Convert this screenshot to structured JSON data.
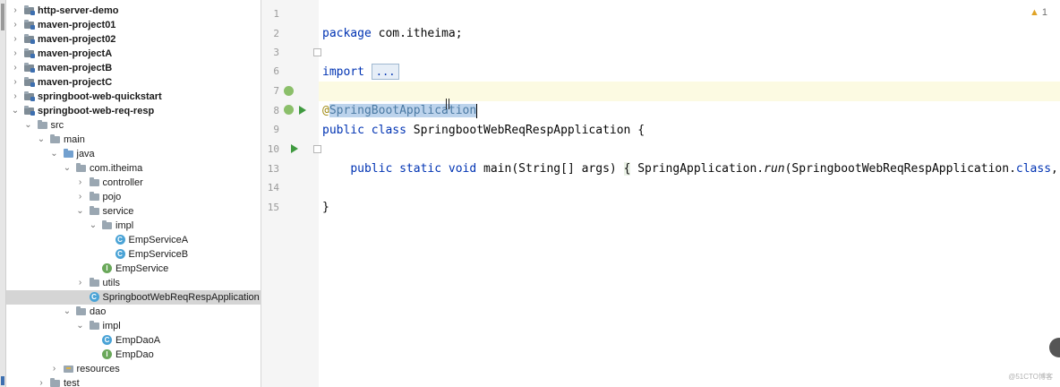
{
  "tree": {
    "items": [
      {
        "label": "http-server-demo",
        "icon": "module-folder-icon",
        "chevron": "right",
        "bold": true
      },
      {
        "label": "maven-project01",
        "icon": "module-folder-icon",
        "chevron": "right",
        "bold": true
      },
      {
        "label": "maven-project02",
        "icon": "module-folder-icon",
        "chevron": "right",
        "bold": true
      },
      {
        "label": "maven-projectA",
        "icon": "module-folder-icon",
        "chevron": "right",
        "bold": true
      },
      {
        "label": "maven-projectB",
        "icon": "module-folder-icon",
        "chevron": "right",
        "bold": true
      },
      {
        "label": "maven-projectC",
        "icon": "module-folder-icon",
        "chevron": "right",
        "bold": true
      },
      {
        "label": "springboot-web-quickstart",
        "icon": "module-folder-icon",
        "chevron": "right",
        "bold": true
      },
      {
        "label": "springboot-web-req-resp",
        "icon": "module-folder-icon",
        "chevron": "down",
        "bold": true
      },
      {
        "label": "src",
        "icon": "folder-icon",
        "chevron": "down"
      },
      {
        "label": "main",
        "icon": "folder-icon",
        "chevron": "down"
      },
      {
        "label": "java",
        "icon": "source-folder-icon",
        "chevron": "down"
      },
      {
        "label": "com.itheima",
        "icon": "package-icon",
        "chevron": "down"
      },
      {
        "label": "controller",
        "icon": "package-icon",
        "chevron": "right"
      },
      {
        "label": "pojo",
        "icon": "package-icon",
        "chevron": "right"
      },
      {
        "label": "service",
        "icon": "package-icon",
        "chevron": "down"
      },
      {
        "label": "impl",
        "icon": "package-icon",
        "chevron": "down"
      },
      {
        "label": "EmpServiceA",
        "icon": "class-icon",
        "chevron": ""
      },
      {
        "label": "EmpServiceB",
        "icon": "class-icon",
        "chevron": ""
      },
      {
        "label": "EmpService",
        "icon": "interface-icon",
        "chevron": ""
      },
      {
        "label": "utils",
        "icon": "package-icon",
        "chevron": "right"
      },
      {
        "label": "SpringbootWebReqRespApplication",
        "icon": "class-icon",
        "chevron": "",
        "selected": true
      },
      {
        "label": "dao",
        "icon": "package-icon",
        "chevron": "down"
      },
      {
        "label": "impl",
        "icon": "package-icon",
        "chevron": "down"
      },
      {
        "label": "EmpDaoA",
        "icon": "class-icon",
        "chevron": ""
      },
      {
        "label": "EmpDao",
        "icon": "interface-icon",
        "chevron": ""
      },
      {
        "label": "resources",
        "icon": "resources-folder-icon",
        "chevron": "right"
      },
      {
        "label": "test",
        "icon": "folder-icon",
        "chevron": "right"
      }
    ]
  },
  "editor": {
    "warning_count": "1",
    "lines": {
      "l1": "1",
      "l2": "2",
      "l3": "3",
      "l6": "6",
      "l7": "7",
      "l8": "8",
      "l9": "9",
      "l10": "10",
      "l13": "13",
      "l14": "14",
      "l15": "15"
    },
    "code": {
      "package_kw": "package",
      "package_name": " com.itheima;",
      "import_kw": "import",
      "import_fold": "...",
      "annotation_at": "@",
      "annotation_name": "SpringBootApplication",
      "class_mods": "public class",
      "class_name": " SpringbootWebReqRespApplication {",
      "main_mods": "public static void",
      "main_sig": " main(String[] args) ",
      "brace_open": "{",
      "main_body_a": " SpringApplication.",
      "main_body_run": "run",
      "main_body_b": "(SpringbootWebReqRespApplication.",
      "main_body_cls": "class",
      "main_body_c": ", a",
      "brace_close": "}"
    }
  },
  "watermark": "@51CTO博客"
}
